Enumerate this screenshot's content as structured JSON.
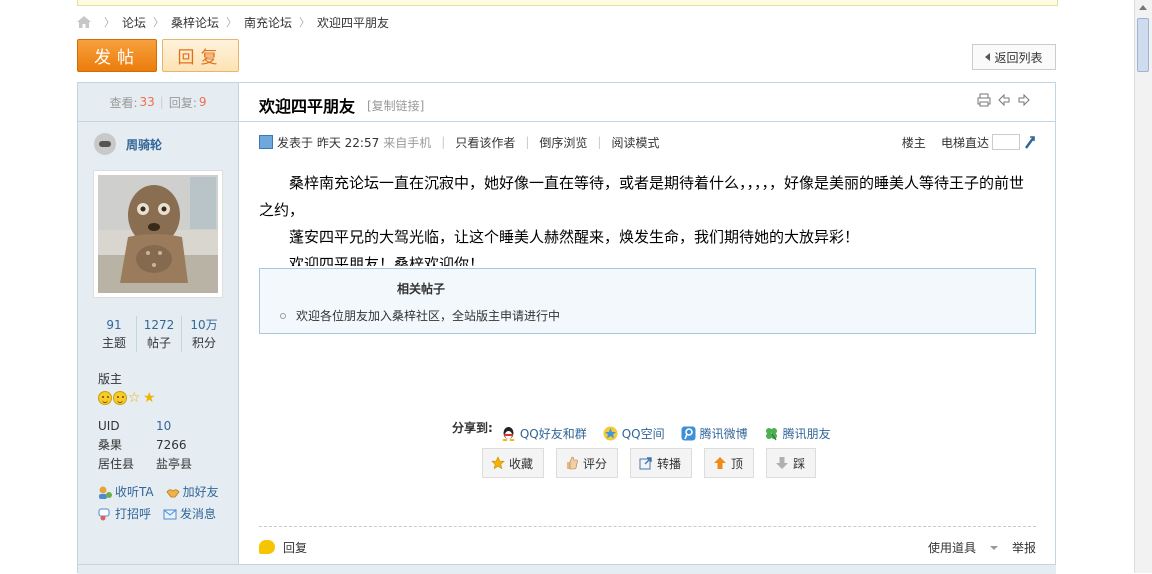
{
  "breadcrumb": {
    "items": [
      "论坛",
      "桑梓论坛",
      "南充论坛",
      "欢迎四平朋友"
    ]
  },
  "actions": {
    "post": "发帖",
    "reply": "回复",
    "back": "返回列表"
  },
  "thread": {
    "views_label": "查看:",
    "views": "33",
    "replies_label": "回复:",
    "replies": "9",
    "title": "欢迎四平朋友",
    "copy_link": "[复制链接]"
  },
  "author": {
    "name": "周骑轮",
    "counts": [
      {
        "num": "91",
        "label": "主题"
      },
      {
        "num": "1272",
        "label": "帖子"
      },
      {
        "num": "10万",
        "label": "积分"
      }
    ],
    "role": "版主",
    "info": [
      {
        "k": "UID",
        "v": "10"
      },
      {
        "k": "桑果",
        "v": "7266"
      },
      {
        "k": "居住县",
        "v": "盐亭县"
      }
    ],
    "links": [
      "收听TA",
      "加好友",
      "打招呼",
      "发消息"
    ]
  },
  "post": {
    "posted_prefix": "发表于",
    "time": "昨天 22:57",
    "from": "来自手机",
    "author_only": "只看该作者",
    "reverse": "倒序浏览",
    "read_mode": "阅读模式",
    "floor": "楼主",
    "elevator": "电梯直达",
    "paragraphs": [
      "桑梓南充论坛一直在沉寂中，她好像一直在等待，或者是期待着什么，，，，，好像是美丽的睡美人等待王子的前世之约，",
      "蓬安四平兄的大驾光临，让这个睡美人赫然醒来，焕发生命，我们期待她的大放异彩！",
      "欢迎四平朋友！桑梓欢迎你！"
    ]
  },
  "related": {
    "heading": "相关帖子",
    "items": [
      "欢迎各位朋友加入桑梓社区，全站版主申请进行中"
    ]
  },
  "share": {
    "label": "分享到:",
    "items": [
      "QQ好友和群",
      "QQ空间",
      "腾讯微博",
      "腾讯朋友"
    ]
  },
  "post_actions": [
    "收藏",
    "评分",
    "转播",
    "顶",
    "踩"
  ],
  "footer": {
    "reply": "回复",
    "tools": "使用道具",
    "report": "举报"
  },
  "colors": {
    "accent_orange": "#ec7c0c",
    "link_blue": "#336699",
    "count_red": "#f26c4f",
    "side_bg": "#e5edf2"
  }
}
